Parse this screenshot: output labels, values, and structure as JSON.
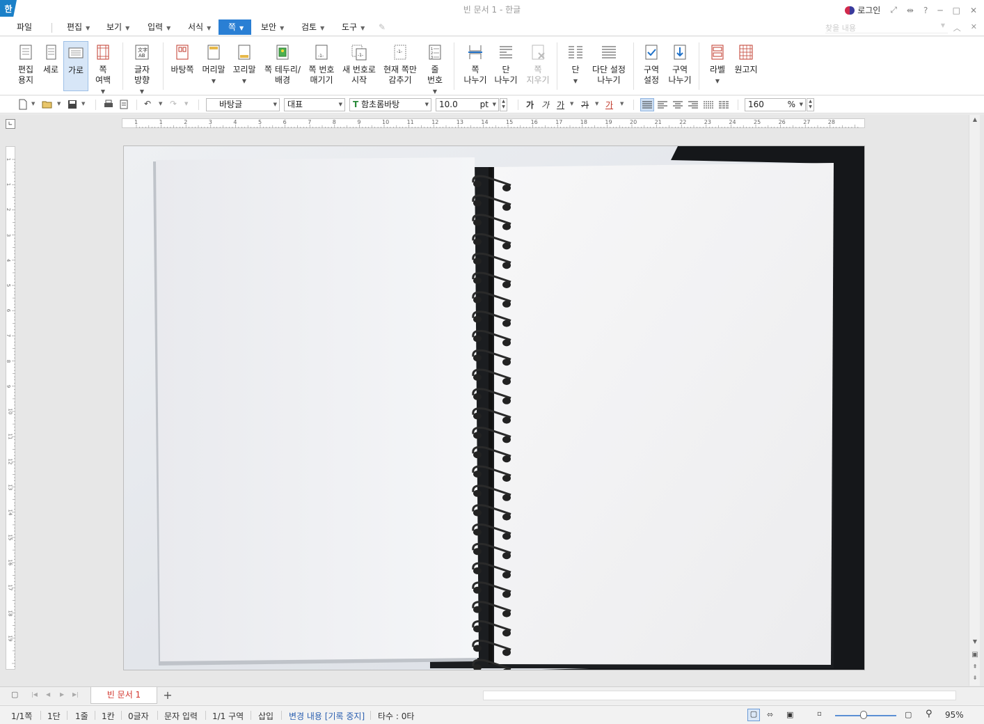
{
  "titlebar": {
    "logo": "한",
    "doc_title": "빈 문서 1 - 한글",
    "login": "로그인",
    "help": "?"
  },
  "menu": {
    "items": [
      {
        "label": "파일",
        "dropdown": false
      },
      {
        "label": "편집",
        "dropdown": true
      },
      {
        "label": "보기",
        "dropdown": true
      },
      {
        "label": "입력",
        "dropdown": true
      },
      {
        "label": "서식",
        "dropdown": true
      },
      {
        "label": "쪽",
        "dropdown": true,
        "active": true
      },
      {
        "label": "보안",
        "dropdown": true
      },
      {
        "label": "검토",
        "dropdown": true
      },
      {
        "label": "도구",
        "dropdown": true
      }
    ],
    "search_placeholder": "찾을 내용"
  },
  "ribbon": {
    "buttons": [
      {
        "id": "edit-paper",
        "label": "편집\n용지",
        "icon": "page-setup-icon"
      },
      {
        "id": "portrait",
        "label": "세로",
        "icon": "portrait-icon"
      },
      {
        "id": "landscape",
        "label": "가로",
        "icon": "landscape-icon",
        "active": true
      },
      {
        "id": "page-margin",
        "label": "쪽\n여백",
        "icon": "margin-icon",
        "dropdown": true
      },
      {
        "id": "text-direction",
        "label": "글자\n방향",
        "icon": "text-direction-icon",
        "dropdown": true
      },
      {
        "id": "background-page",
        "label": "바탕쪽",
        "icon": "background-page-icon"
      },
      {
        "id": "header",
        "label": "머리말",
        "icon": "header-icon",
        "dropdown": true
      },
      {
        "id": "footer",
        "label": "꼬리말",
        "icon": "footer-icon",
        "dropdown": true
      },
      {
        "id": "page-border",
        "label": "쪽 테두리/\n배경",
        "icon": "page-border-icon"
      },
      {
        "id": "page-number",
        "label": "쪽 번호\n매기기",
        "icon": "page-number-icon"
      },
      {
        "id": "new-number",
        "label": "새 번호로\n시작",
        "icon": "new-number-icon"
      },
      {
        "id": "hide-current",
        "label": "현재 쪽만\n감추기",
        "icon": "hide-page-icon"
      },
      {
        "id": "line-number",
        "label": "줄\n번호",
        "icon": "line-number-icon",
        "dropdown": true
      },
      {
        "id": "page-break",
        "label": "쪽\n나누기",
        "icon": "page-break-icon"
      },
      {
        "id": "column-break",
        "label": "단\n나누기",
        "icon": "column-break-icon"
      },
      {
        "id": "page-delete",
        "label": "쪽\n지우기",
        "icon": "page-delete-icon",
        "disabled": true
      },
      {
        "id": "columns",
        "label": "단",
        "icon": "columns-icon",
        "dropdown": true
      },
      {
        "id": "multi-column",
        "label": "다단 설정\n나누기",
        "icon": "multi-column-icon"
      },
      {
        "id": "section-setup",
        "label": "구역\n설정",
        "icon": "section-setup-icon"
      },
      {
        "id": "section-break",
        "label": "구역\n나누기",
        "icon": "section-break-icon"
      },
      {
        "id": "label",
        "label": "라벨",
        "icon": "label-icon",
        "dropdown": true
      },
      {
        "id": "manuscript",
        "label": "원고지",
        "icon": "manuscript-icon"
      }
    ]
  },
  "format": {
    "style": "바탕글",
    "language": "대표",
    "font": "함초롬바탕",
    "font_size": "10.0",
    "font_unit": "pt",
    "bold": "가",
    "italic": "가",
    "underline": "가",
    "strike": "가",
    "color_glyph": "가",
    "line_spacing": "160",
    "line_spacing_unit": "%"
  },
  "ruler": {
    "h_ticks": [
      "1",
      "1",
      "2",
      "3",
      "4",
      "5",
      "6",
      "7",
      "8",
      "9",
      "10",
      "11",
      "12",
      "13",
      "14",
      "15",
      "16",
      "17",
      "18",
      "19",
      "20",
      "21",
      "22",
      "23",
      "24",
      "25",
      "26",
      "27",
      "28"
    ],
    "v_ticks": [
      "1",
      "1",
      "2",
      "3",
      "4",
      "5",
      "6",
      "7",
      "8",
      "9",
      "10",
      "11",
      "12",
      "13",
      "14",
      "15",
      "16",
      "17",
      "18",
      "19"
    ]
  },
  "tabs": {
    "doc_tab": "빈 문서 1",
    "add": "+"
  },
  "status": {
    "page": "1/1쪽",
    "column": "1단",
    "line": "1줄",
    "col": "1칸",
    "chars": "0글자",
    "mode": "문자 입력",
    "section": "1/1 구역",
    "insert": "삽입",
    "track": "변경 내용 [기록 중지]",
    "typing": "타수 : 0타",
    "zoom": "95%"
  },
  "colors": {
    "accent": "#2a7fd4",
    "tab_text": "#d2332b",
    "logo_bg": "#1b80c8"
  }
}
